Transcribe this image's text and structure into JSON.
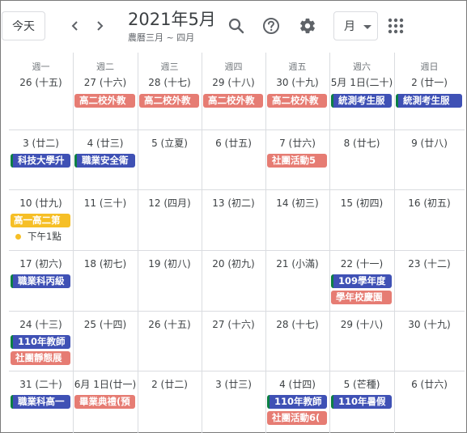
{
  "header": {
    "today_label": "今天",
    "title": "2021年5月",
    "subtitle": "農曆三月 ~ 四月",
    "view_label": "月",
    "icons": {
      "prev": "chevron-left-icon",
      "next": "chevron-right-icon",
      "search": "search-icon",
      "help": "help-icon",
      "settings": "gear-icon",
      "view_dropdown": "caret-down-icon",
      "apps": "apps-grid-icon"
    }
  },
  "colors": {
    "blue_event": "#3f51b5",
    "blue_event_stripe": "#0b8043",
    "red_event": "#e67c73",
    "yellow_event": "#f6bf26"
  },
  "weekdays": [
    "週一",
    "週二",
    "週三",
    "週四",
    "週五",
    "週六",
    "週日"
  ],
  "weeks": [
    {
      "days": [
        {
          "label": "26 (十五)"
        },
        {
          "label": "27 (十六)"
        },
        {
          "label": "28 (十七)"
        },
        {
          "label": "29 (十八)"
        },
        {
          "label": "30 (十九)"
        },
        {
          "label": "5月 1日(二十)"
        },
        {
          "label": "2 (廿一)"
        }
      ],
      "events": [
        {
          "col": 1,
          "row": 0,
          "text": "高二校外教",
          "color": "red"
        },
        {
          "col": 2,
          "row": 0,
          "text": "高二校外教",
          "color": "red"
        },
        {
          "col": 3,
          "row": 0,
          "text": "高二校外教",
          "color": "red"
        },
        {
          "col": 4,
          "row": 0,
          "text": "高二校外教",
          "color": "red"
        },
        {
          "col": 5,
          "row": 0,
          "text": "統測考生服",
          "color": "blue"
        },
        {
          "col": 6,
          "row": 0,
          "text": "統測考生服",
          "color": "blue"
        }
      ]
    },
    {
      "days": [
        {
          "label": "3 (廿二)"
        },
        {
          "label": "4 (廿三)"
        },
        {
          "label": "5 (立夏)"
        },
        {
          "label": "6 (廿五)"
        },
        {
          "label": "7 (廿六)"
        },
        {
          "label": "8 (廿七)"
        },
        {
          "label": "9 (廿八)"
        }
      ],
      "events": [
        {
          "col": 0,
          "row": 0,
          "text": "科技大學升",
          "color": "blue"
        },
        {
          "col": 1,
          "row": 0,
          "text": "職業安全衛",
          "color": "blue"
        },
        {
          "col": 4,
          "row": 0,
          "text": "社團活動5",
          "color": "red"
        }
      ]
    },
    {
      "days": [
        {
          "label": "10 (廿九)"
        },
        {
          "label": "11 (三十)"
        },
        {
          "label": "12 (四月)"
        },
        {
          "label": "13 (初二)"
        },
        {
          "label": "14 (初三)"
        },
        {
          "label": "15 (初四)"
        },
        {
          "label": "16 (初五)"
        }
      ],
      "events": [
        {
          "col": 0,
          "row": 0,
          "text": "高一高二第",
          "color": "yellow"
        },
        {
          "col": 0,
          "row": 1,
          "text": "下午1點",
          "color": "timed"
        }
      ]
    },
    {
      "days": [
        {
          "label": "17 (初六)"
        },
        {
          "label": "18 (初七)"
        },
        {
          "label": "19 (初八)"
        },
        {
          "label": "20 (初九)"
        },
        {
          "label": "21 (小滿)"
        },
        {
          "label": "22 (十一)"
        },
        {
          "label": "23 (十二)"
        }
      ],
      "events": [
        {
          "col": 0,
          "row": 0,
          "text": "職業科丙級",
          "color": "blue"
        },
        {
          "col": 5,
          "row": 0,
          "text": "109學年度",
          "color": "blue"
        },
        {
          "col": 5,
          "row": 1,
          "text": "學年校慶園",
          "color": "red"
        }
      ]
    },
    {
      "days": [
        {
          "label": "24 (十三)"
        },
        {
          "label": "25 (十四)"
        },
        {
          "label": "26 (十五)"
        },
        {
          "label": "27 (十六)"
        },
        {
          "label": "28 (十七)"
        },
        {
          "label": "29 (十八)"
        },
        {
          "label": "30 (十九)"
        }
      ],
      "events": [
        {
          "col": 0,
          "row": 0,
          "text": "110年教師",
          "color": "blue"
        },
        {
          "col": 0,
          "row": 1,
          "text": "社團靜態展",
          "color": "red"
        }
      ]
    },
    {
      "days": [
        {
          "label": "31 (二十)"
        },
        {
          "label": "6月 1日(廿一)"
        },
        {
          "label": "2 (廿二)"
        },
        {
          "label": "3 (廿三)"
        },
        {
          "label": "4 (廿四)"
        },
        {
          "label": "5 (芒種)"
        },
        {
          "label": "6 (廿六)"
        }
      ],
      "events": [
        {
          "col": 0,
          "row": 0,
          "text": "職業科高一",
          "color": "blue"
        },
        {
          "col": 1,
          "row": 0,
          "text": "畢業典禮(預",
          "color": "red"
        },
        {
          "col": 4,
          "row": 0,
          "text": "110年教師",
          "color": "blue"
        },
        {
          "col": 5,
          "row": 0,
          "text": "110年暑假",
          "color": "blue"
        },
        {
          "col": 4,
          "row": 1,
          "text": "社團活動6(",
          "color": "red"
        }
      ]
    }
  ]
}
